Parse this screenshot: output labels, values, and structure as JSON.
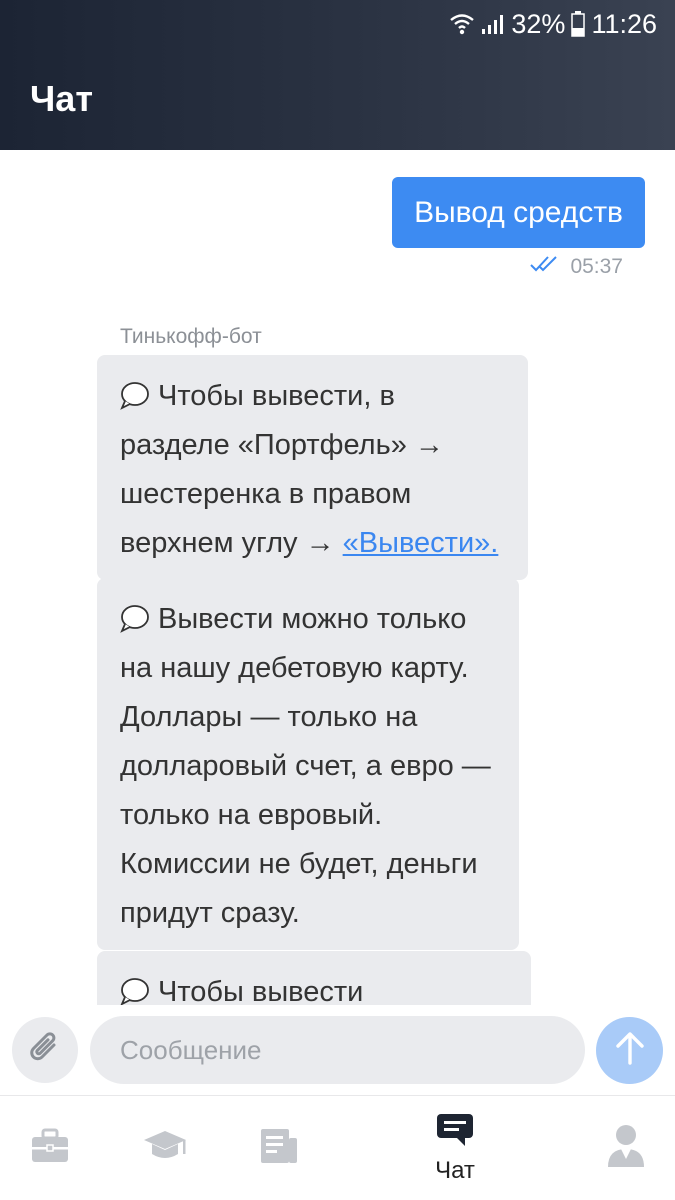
{
  "statusbar": {
    "battery": "32%",
    "time": "11:26"
  },
  "header": {
    "title": "Чат"
  },
  "messages": {
    "outgoing": {
      "text": "Вывод средств",
      "time": "05:37"
    },
    "sender": "Тинькофф-бот",
    "bot": [
      {
        "text": "Чтобы вывести, в разделе «Портфель» → шестеренка в правом верхнем углу → ",
        "link": "«Вывести»."
      },
      {
        "text": "Вывести можно только на нашу дебетовую карту. Доллары — только на долларовый счет, а евро — только на евровый. Комиссии не будет, деньги придут сразу."
      },
      {
        "text": "Чтобы вывести"
      }
    ]
  },
  "input": {
    "placeholder": "Сообщение"
  },
  "nav": {
    "items": [
      "portfolio-icon",
      "education-icon",
      "news-icon",
      "chat-icon",
      "profile-icon"
    ],
    "chat_label": "Чат"
  },
  "colors": {
    "accent": "#3d8bf2",
    "header": "#1c2434",
    "bubble": "#eaebee",
    "send_disabled": "#a9cbf8"
  }
}
